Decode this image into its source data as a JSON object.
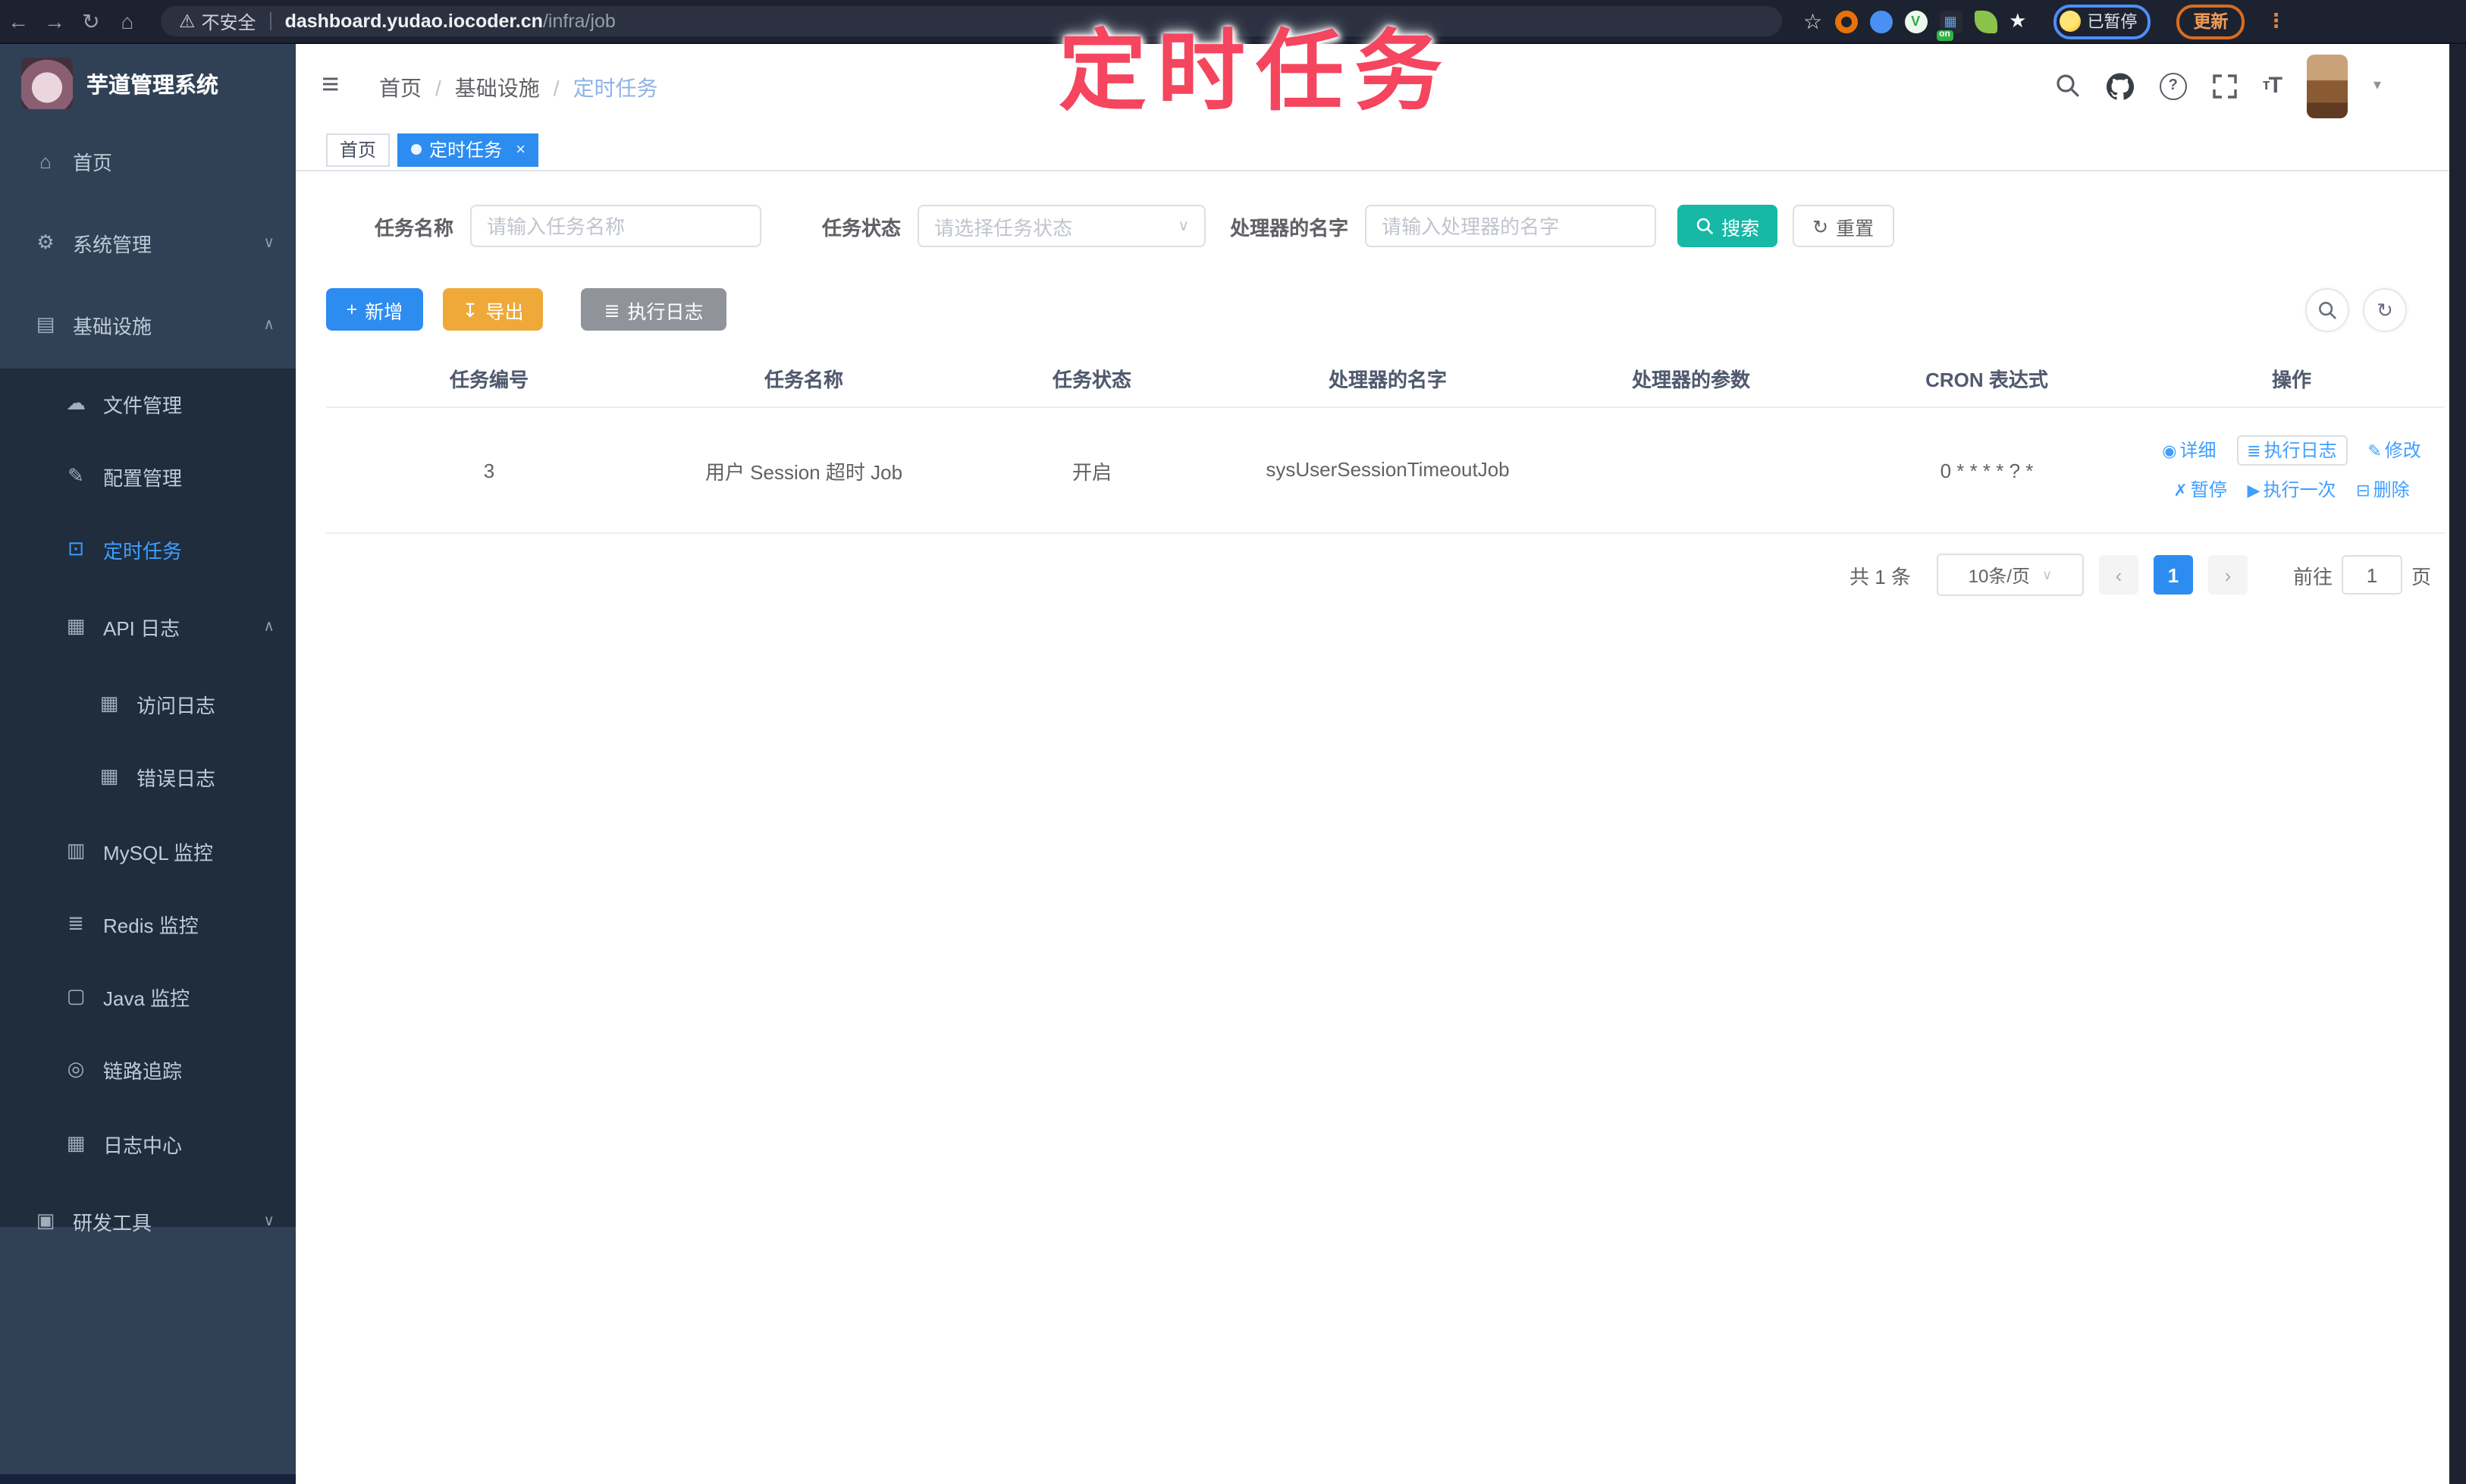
{
  "browser": {
    "security_label": "不安全",
    "url_domain": "dashboard.yudao.iocoder.cn",
    "url_path": "/infra/job",
    "paused_badge": "已暂停",
    "update_button": "更新",
    "extension_on_badge": "on",
    "back_glyph": "←",
    "forward_glyph": "→",
    "reload_glyph": "↻",
    "home_glyph": "⌂",
    "warning_glyph": "⚠",
    "bookmark_star_glyph": "☆",
    "kebab_glyph": "⋮"
  },
  "annotation": {
    "text": "定时任务",
    "color": "#f5455f"
  },
  "sidebar": {
    "title": "芋道管理系统",
    "items": [
      {
        "label": "首页",
        "glyph": "⌂",
        "chevron": ""
      },
      {
        "label": "系统管理",
        "glyph": "⚙",
        "chevron": "∨"
      },
      {
        "label": "基础设施",
        "glyph": "▤",
        "chevron": "∧"
      },
      {
        "label": "文件管理",
        "glyph": "☁",
        "chevron": ""
      },
      {
        "label": "配置管理",
        "glyph": "✎",
        "chevron": ""
      },
      {
        "label": "定时任务",
        "glyph": "⊡",
        "chevron": ""
      },
      {
        "label": "API 日志",
        "glyph": "▦",
        "chevron": "∧"
      },
      {
        "label": "访问日志",
        "glyph": "▦",
        "chevron": ""
      },
      {
        "label": "错误日志",
        "glyph": "▦",
        "chevron": ""
      },
      {
        "label": "MySQL 监控",
        "glyph": "▥",
        "chevron": ""
      },
      {
        "label": "Redis 监控",
        "glyph": "≣",
        "chevron": ""
      },
      {
        "label": "Java 监控",
        "glyph": "▢",
        "chevron": ""
      },
      {
        "label": "链路追踪",
        "glyph": "◎",
        "chevron": ""
      },
      {
        "label": "日志中心",
        "glyph": "▦",
        "chevron": ""
      },
      {
        "label": "研发工具",
        "glyph": "▣",
        "chevron": "∨"
      }
    ]
  },
  "header": {
    "collapse_glyph": "≡",
    "breadcrumb": [
      "首页",
      "基础设施",
      "定时任务"
    ],
    "separator": "/",
    "font_size_glyph": "tT",
    "caret_glyph": "▾"
  },
  "tabs": [
    {
      "label": "首页"
    },
    {
      "label": "定时任务",
      "close_glyph": "×"
    }
  ],
  "filters": {
    "task_name_label": "任务名称",
    "task_name_placeholder": "请输入任务名称",
    "task_status_label": "任务状态",
    "task_status_placeholder": "请选择任务状态",
    "handler_label": "处理器的名字",
    "handler_placeholder": "请输入处理器的名字",
    "search_label": "搜索",
    "reset_label": "重置",
    "reset_glyph": "↻",
    "select_caret_glyph": "∨"
  },
  "actions": {
    "add": "新增",
    "add_glyph": "+",
    "export": "导出",
    "export_glyph": "↧",
    "exec_log": "执行日志",
    "exec_log_glyph": "≣",
    "refresh_tool_glyph": "↻"
  },
  "table": {
    "columns": [
      "任务编号",
      "任务名称",
      "任务状态",
      "处理器的名字",
      "处理器的参数",
      "CRON 表达式",
      "操作"
    ],
    "rows": [
      {
        "id": "3",
        "name": "用户 Session 超时 Job",
        "status": "开启",
        "handler": "sysUserSessionTimeoutJob",
        "param": "",
        "cron": "0 * * * * ? *",
        "ops": [
          {
            "label": "详细",
            "glyph": "◉"
          },
          {
            "label": "执行日志",
            "glyph": "≣"
          },
          {
            "label": "修改",
            "glyph": "✎"
          },
          {
            "label": "暂停",
            "glyph": "✗"
          },
          {
            "label": "执行一次",
            "glyph": "▶"
          },
          {
            "label": "删除",
            "glyph": "⊟"
          }
        ]
      }
    ]
  },
  "pagination": {
    "total": "共 1 条",
    "page_size": "10条/页",
    "prev_glyph": "‹",
    "current_page": "1",
    "next_glyph": "›",
    "jump_prefix": "前往",
    "jump_value": "1",
    "jump_suffix": "页"
  },
  "colors": {
    "primary": "#2d8cf0",
    "link": "#409eff",
    "search_button": "#17b8a6",
    "export_button": "#efa939",
    "info_button": "#909399",
    "sidebar_bg": "#304156",
    "submenu_bg": "#1f2d3d",
    "annotation": "#f5455f"
  }
}
